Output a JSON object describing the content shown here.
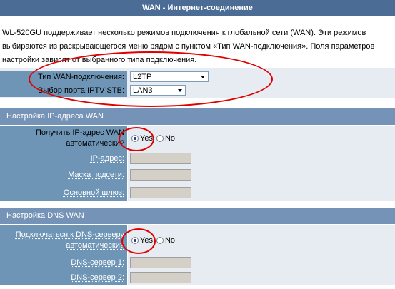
{
  "title": "WAN - Интернет-соединение",
  "description": "WL-520GU поддерживает несколько режимов подключения к глобальной сети (WAN). Эти режимов выбираются из раскрывающегося меню рядом с пунктом «Тип WAN-подключения». Поля параметров настройки зависят от выбранного типа подключения.",
  "conn": {
    "type_label": "Тип WAN-подключения:",
    "type_value": "L2TP",
    "iptv_label": "Выбор порта IPTV STB:",
    "iptv_value": "LAN3"
  },
  "ip_section": {
    "header": "Настройка IP-адреса WAN",
    "auto_label": "Получить IP-адрес WAN автоматически?",
    "yes": "Yes",
    "no": "No",
    "ip_label": "IP-адрес:",
    "mask_label": "Маска подсети:",
    "gateway_label": "Основной шлюз:"
  },
  "dns_section": {
    "header": "Настройка DNS WAN",
    "auto_label": "Подключаться к DNS-серверу автоматически?",
    "yes": "Yes",
    "no": "No",
    "dns1_label": "DNS-сервер 1:",
    "dns2_label": "DNS-сервер 2:"
  },
  "colors": {
    "title_bg": "#4a6c95",
    "section_bg": "#7493b6",
    "label_bg": "#6e95b6",
    "value_bg": "#e6ecf2",
    "annotation": "#e00000"
  }
}
